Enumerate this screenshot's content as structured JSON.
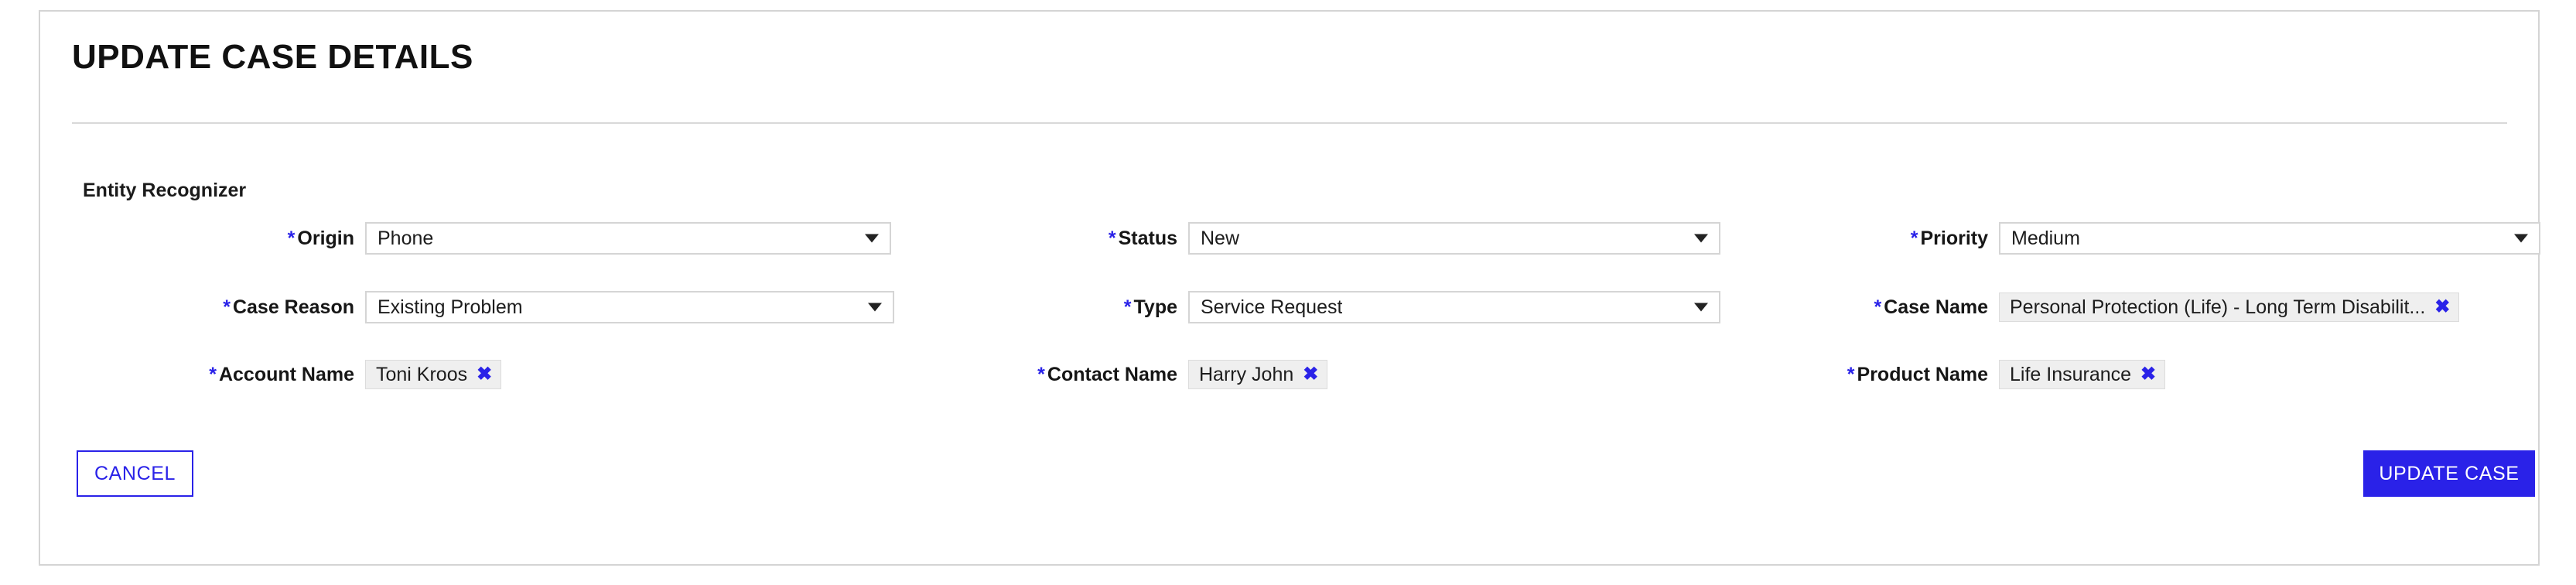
{
  "page": {
    "title": "UPDATE CASE DETAILS",
    "section_title": "Entity Recognizer",
    "required_marker": "*",
    "accent_color": "#2a22e8",
    "chip_background": "#efefef",
    "border_color": "#d4d4d4"
  },
  "form": {
    "rows": [
      {
        "origin": {
          "label": "Origin",
          "value": "Phone",
          "type": "select",
          "icon": "chevron-down-icon"
        },
        "status": {
          "label": "Status",
          "value": "New",
          "type": "select",
          "icon": "chevron-down-icon"
        },
        "priority": {
          "label": "Priority",
          "value": "Medium",
          "type": "select",
          "icon": "chevron-down-icon"
        }
      },
      {
        "case_reason": {
          "label": "Case Reason",
          "value": "Existing Problem",
          "type": "select",
          "icon": "chevron-down-icon"
        },
        "type": {
          "label": "Type",
          "value": "Service Request",
          "type": "select",
          "icon": "chevron-down-icon"
        },
        "case_name": {
          "label": "Case Name",
          "value": "Personal Protection (Life) - Long Term Disabilit...",
          "type": "chip",
          "remove_icon": "close-icon"
        }
      },
      {
        "account_name": {
          "label": "Account Name",
          "value": "Toni Kroos",
          "type": "chip",
          "remove_icon": "close-icon"
        },
        "contact_name": {
          "label": "Contact Name",
          "value": "Harry John",
          "type": "chip",
          "remove_icon": "close-icon"
        },
        "product_name": {
          "label": "Product Name",
          "value": "Life Insurance",
          "type": "chip",
          "remove_icon": "close-icon"
        }
      }
    ]
  },
  "actions": {
    "cancel_label": "CANCEL",
    "submit_label": "UPDATE CASE"
  }
}
